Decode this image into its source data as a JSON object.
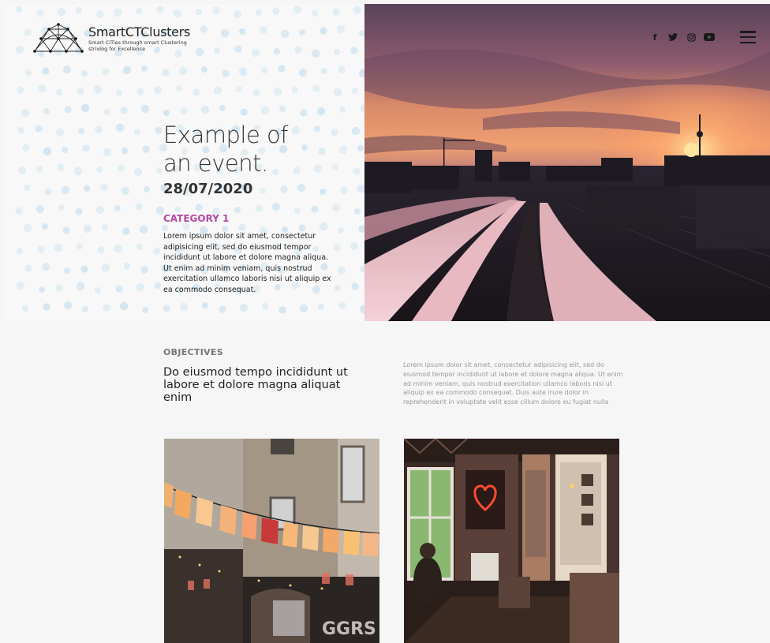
{
  "brand": {
    "name": "SmartCTClusters",
    "tagline": "Smart CiTies through smart Clustering striving for Excellence"
  },
  "event": {
    "title": "Example of an event.",
    "date": "28/07/2020",
    "category": "CATEGORY 1",
    "description": "Lorem ipsum dolor sit amet, consectetur adipisicing elit, sed do eiusmod tempor incididunt ut labore et dolore magna aliqua. Ut enim ad minim veniam, quis nostrud exercitation ullamco laboris nisi ut aliquip ex ea commodo consequat."
  },
  "social_icons": [
    "facebook-icon",
    "twitter-icon",
    "instagram-icon",
    "youtube-icon"
  ],
  "objectives": {
    "label": "OBJECTIVES",
    "heading": "Do eiusmod tempo incididunt ut labore et dolore magna aliquat enim",
    "text": "Lorem ipsum dolor sit amet, consectetur adipisicing elit, sed do eiusmod tempor incididunt ut labore et dolore magna aliqua. Ut enim ad minim veniam, quis nostrud exercitation ullamco laboris nisi ut aliquip ex ea commodo consequat. Duis aute irure dolor in reprehenderit in voluptate velit esse cillum dolore eu fugiat nulla"
  },
  "colors": {
    "accent": "#b44aa2",
    "dot": "#cfe3f0",
    "background": "#f6f6f6"
  }
}
